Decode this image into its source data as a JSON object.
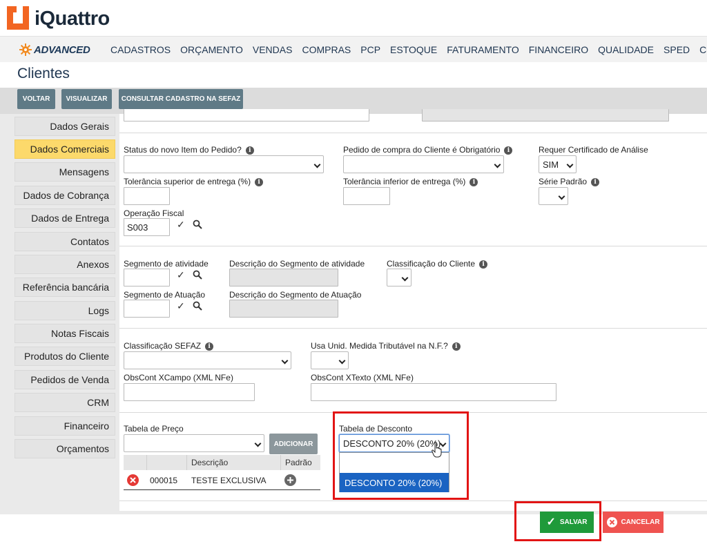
{
  "app": {
    "brand": "iQuattro",
    "edition": "ADVANCED",
    "brand_color": "#f26522"
  },
  "nav": {
    "items": [
      "CADASTROS",
      "ORÇAMENTO",
      "VENDAS",
      "COMPRAS",
      "PCP",
      "ESTOQUE",
      "FATURAMENTO",
      "FINANCEIRO",
      "QUALIDADE",
      "SPED",
      "CONF"
    ]
  },
  "page": {
    "title": "Clientes"
  },
  "toolbar": {
    "back": "VOLTAR",
    "view": "VISUALIZAR",
    "sefaz": "CONSULTAR CADASTRO NA SEFAZ"
  },
  "sidebar": {
    "items": [
      "Dados Gerais",
      "Dados Comerciais",
      "Mensagens",
      "Dados de Cobrança",
      "Dados de Entrega",
      "Contatos",
      "Anexos",
      "Referência bancária",
      "Logs",
      "Notas Fiscais",
      "Produtos do Cliente",
      "Pedidos de Venda",
      "CRM",
      "Financeiro",
      "Orçamentos"
    ],
    "active": "Dados Comerciais",
    "active_color": "#fcd96b"
  },
  "form": {
    "status_item": {
      "label": "Status do novo Item do Pedido?",
      "value": ""
    },
    "pedido_obrig": {
      "label": "Pedido de compra do Cliente é Obrigatório",
      "value": ""
    },
    "certificado": {
      "label": "Requer Certificado de Análise",
      "value": "SIM"
    },
    "tol_sup": {
      "label": "Tolerância superior de entrega (%)",
      "value": ""
    },
    "tol_inf": {
      "label": "Tolerância inferior de entrega (%)",
      "value": ""
    },
    "serie": {
      "label": "Série Padrão",
      "value": ""
    },
    "operacao": {
      "label": "Operação Fiscal",
      "value": "S003"
    },
    "segmento": {
      "label": "Segmento de atividade",
      "value": ""
    },
    "desc_segmento": {
      "label": "Descrição do Segmento de atividade",
      "value": ""
    },
    "classificacao": {
      "label": "Classificação do Cliente",
      "value": ""
    },
    "seg_atuacao": {
      "label": "Segmento de Atuação",
      "value": ""
    },
    "desc_atuacao": {
      "label": "Descrição do Segmento de Atuação",
      "value": ""
    },
    "class_sefaz": {
      "label": "Classificação SEFAZ",
      "value": ""
    },
    "unid_trib": {
      "label": "Usa Unid. Medida Tributável na N.F.?",
      "value": ""
    },
    "obs_xcampo": {
      "label": "ObsCont XCampo (XML NFe)",
      "value": ""
    },
    "obs_xtexto": {
      "label": "ObsCont XTexto (XML NFe)",
      "value": ""
    },
    "tabela_preco": {
      "label": "Tabela de Preço",
      "value": "",
      "add_button": "ADICIONAR"
    },
    "tabela_desconto": {
      "label": "Tabela de Desconto",
      "value": "DESCONTO 20% (20%)",
      "options": [
        "",
        "DESCONTO 20% (20%)"
      ]
    }
  },
  "price_table": {
    "columns": [
      "",
      "",
      "Descrição",
      "Padrão"
    ],
    "rows": [
      {
        "code": "000015",
        "description": "TESTE EXCLUSIVA"
      }
    ]
  },
  "actions": {
    "save": "SALVAR",
    "cancel": "CANCELAR",
    "save_color": "#1f9a3a",
    "cancel_color": "#ef5350"
  },
  "highlight_color": "#e21414"
}
